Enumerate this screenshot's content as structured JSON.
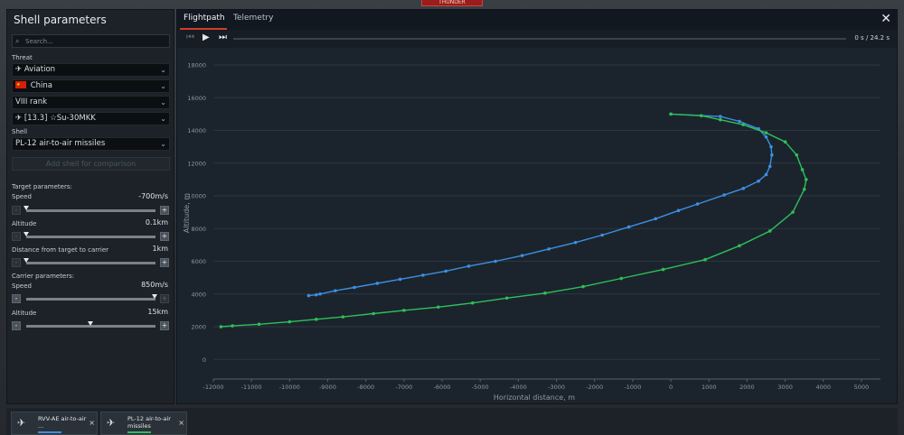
{
  "top_banner": {
    "text": "THUNDER"
  },
  "left_panel": {
    "title": "Shell parameters",
    "search": {
      "placeholder": "Search...",
      "value": ""
    },
    "threat_label": "Threat",
    "threat_type": "Aviation",
    "country": "China",
    "rank": "VIII rank",
    "vehicle": "[13.3] ☆Su-30MKK",
    "shell_label": "Shell",
    "shell": "PL-12 air-to-air missiles",
    "add_comparison_label": "Add shell for comparison",
    "target_params": {
      "heading": "Target parameters:",
      "speed_label": "Speed",
      "speed_value": "-700m/s",
      "speed_level": 0.0,
      "altitude_label": "Altitude",
      "altitude_value": "0.1km",
      "altitude_level": 0.0,
      "distance_label": "Distance from target to carrier",
      "distance_value": "1km",
      "distance_level": 0.0
    },
    "carrier_params": {
      "heading": "Carrier parameters:",
      "speed_label": "Speed",
      "speed_value": "850m/s",
      "speed_level": 1.0,
      "altitude_label": "Altitude",
      "altitude_value": "15km",
      "altitude_level": 0.5
    },
    "stepper_minus": "-",
    "stepper_plus": "+"
  },
  "main_panel": {
    "tabs": [
      {
        "label": "Flightpath"
      },
      {
        "label": "Telemetry"
      }
    ],
    "close_icon": "close-icon",
    "playback": {
      "time_current": "0 s",
      "time_sep": "/",
      "time_total": "24.2 s"
    }
  },
  "chart_data": {
    "type": "line",
    "xlabel": "Horizontal distance, m",
    "ylabel": "Altitude, m",
    "xlim": [
      -12000,
      5500
    ],
    "ylim": [
      -1200,
      18000
    ],
    "x_ticks": [
      -12000,
      -11000,
      -10000,
      -9000,
      -8000,
      -7000,
      -6000,
      -5000,
      -4000,
      -3000,
      -2000,
      -1000,
      0,
      1000,
      2000,
      3000,
      4000,
      5000
    ],
    "y_ticks": [
      0,
      2000,
      4000,
      6000,
      8000,
      10000,
      12000,
      14000,
      16000,
      18000
    ],
    "grid": true,
    "series": [
      {
        "name": "RVV-AE air-to-air ...",
        "color": "#3d8ee3",
        "x": [
          -9500,
          -9300,
          -9200,
          -8800,
          -8300,
          -7700,
          -7100,
          -6500,
          -5900,
          -5300,
          -4600,
          -3900,
          -3200,
          -2500,
          -1800,
          -1100,
          -400,
          200,
          700,
          1400,
          1900,
          2300,
          2500,
          2600,
          2650,
          2630,
          2500,
          2300,
          1800,
          1300,
          0
        ],
        "y": [
          3900,
          3950,
          4000,
          4200,
          4400,
          4650,
          4900,
          5150,
          5400,
          5700,
          6000,
          6350,
          6750,
          7150,
          7600,
          8100,
          8600,
          9100,
          9500,
          10050,
          10450,
          10900,
          11300,
          11800,
          12500,
          13000,
          13600,
          14100,
          14550,
          14850,
          15000
        ]
      },
      {
        "name": "PL-12 air-to-air missiles",
        "color": "#2fbf5a",
        "x": [
          -11800,
          -11500,
          -10800,
          -10000,
          -9300,
          -8600,
          -7800,
          -7000,
          -6100,
          -5200,
          -4300,
          -3300,
          -2300,
          -1300,
          -200,
          900,
          1800,
          2600,
          3200,
          3500,
          3550,
          3450,
          3300,
          3000,
          2500,
          1900,
          1300,
          800,
          0
        ],
        "y": [
          2000,
          2050,
          2150,
          2300,
          2450,
          2600,
          2800,
          3000,
          3200,
          3450,
          3750,
          4050,
          4450,
          4950,
          5500,
          6100,
          6950,
          7850,
          9000,
          10400,
          11000,
          11600,
          12500,
          13300,
          13850,
          14350,
          14650,
          14900,
          15000
        ]
      }
    ]
  },
  "bottom_bar": {
    "cards": [
      {
        "name": "RVV-AE air-to-air ...",
        "color": "#3d8ee3"
      },
      {
        "name": "PL-12 air-to-air missiles",
        "color": "#2fbf5a"
      }
    ],
    "close_glyph": "×"
  }
}
